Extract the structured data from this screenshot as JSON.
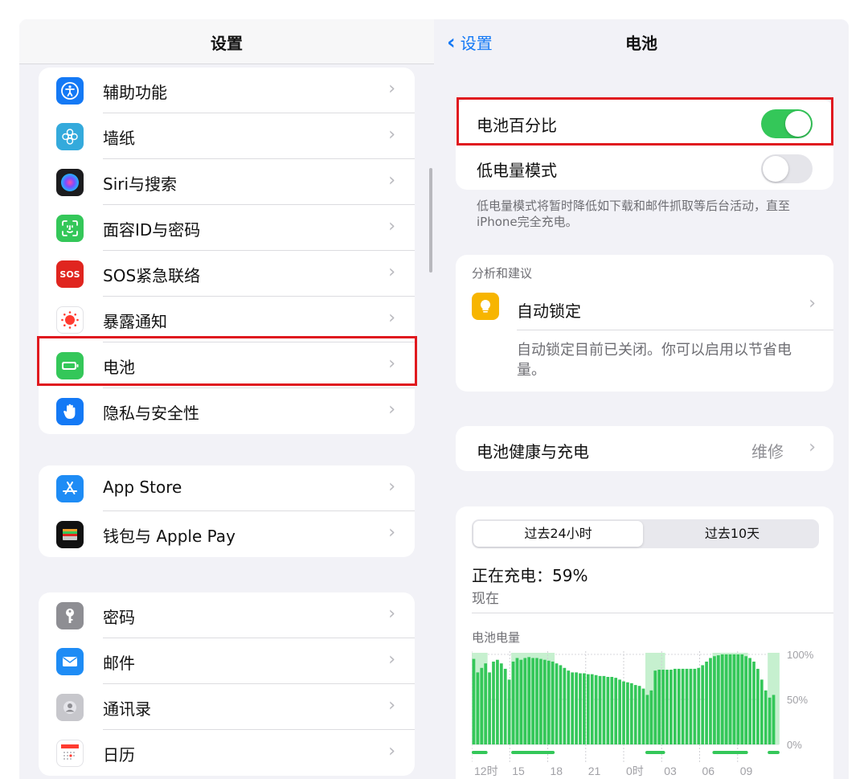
{
  "sidebar": {
    "title": "设置",
    "groups": [
      {
        "items": [
          {
            "label": "辅助功能",
            "icon": "accessibility-icon",
            "color": "#1479f5"
          },
          {
            "label": "墙纸",
            "icon": "wallpaper-flower-icon",
            "color": "#34aadc"
          },
          {
            "label": "Siri与搜索",
            "icon": "siri-icon",
            "color": "#222222"
          },
          {
            "label": "面容ID与密码",
            "icon": "face-id-icon",
            "color": "#34c759"
          },
          {
            "label": "SOS紧急联络",
            "icon": "sos-icon",
            "color": "#e0251f"
          },
          {
            "label": "暴露通知",
            "icon": "exposure-notification-icon",
            "color": "#ffffff"
          },
          {
            "label": "电池",
            "icon": "battery-icon",
            "color": "#34c759"
          },
          {
            "label": "隐私与安全性",
            "icon": "privacy-hand-icon",
            "color": "#1479f5"
          }
        ]
      },
      {
        "items": [
          {
            "label": "App Store",
            "icon": "app-store-icon",
            "color": "#1e8cf5"
          },
          {
            "label": "钱包与 Apple Pay",
            "icon": "wallet-icon",
            "color": "#111111"
          }
        ]
      },
      {
        "items": [
          {
            "label": "密码",
            "icon": "key-icon",
            "color": "#8e8e93"
          },
          {
            "label": "邮件",
            "icon": "mail-icon",
            "color": "#1e8cf5"
          },
          {
            "label": "通讯录",
            "icon": "contacts-icon",
            "color": "#c7c7cc"
          },
          {
            "label": "日历",
            "icon": "calendar-icon",
            "color": "#ffffff"
          }
        ]
      }
    ]
  },
  "detail": {
    "back_label": "设置",
    "title": "电池",
    "battery_percentage": {
      "label": "电池百分比",
      "on": true
    },
    "low_power": {
      "label": "低电量模式",
      "on": false
    },
    "low_power_note": "低电量模式将暂时降低如下载和邮件抓取等后台活动，直至iPhone完全充电。",
    "insights": {
      "section_label": "分析和建议",
      "title": "自动锁定",
      "description": "自动锁定目前已关闭。你可以启用以节省电量。"
    },
    "health": {
      "label": "电池健康与充电",
      "value": "维修"
    },
    "usage": {
      "tabs": [
        "过去24小时",
        "过去10天"
      ],
      "selected_tab": 0,
      "status": "正在充电：59%",
      "status_time": "现在",
      "chart_title": "电池电量"
    }
  },
  "chart_data": {
    "type": "bar",
    "title": "电池电量",
    "ylim": [
      0,
      100
    ],
    "y_ticks": [
      "100%",
      "50%",
      "0%"
    ],
    "x_ticks": [
      "12时",
      "15",
      "18",
      "21",
      "0时",
      "03",
      "06",
      "09"
    ],
    "bar_color": "#34c759",
    "charging_color": "#c6f0cf",
    "values": [
      95,
      80,
      85,
      90,
      80,
      92,
      94,
      90,
      84,
      72,
      92,
      96,
      94,
      96,
      97,
      96,
      96,
      95,
      94,
      93,
      92,
      90,
      88,
      85,
      82,
      80,
      80,
      79,
      79,
      78,
      78,
      77,
      76,
      76,
      75,
      75,
      74,
      72,
      70,
      69,
      68,
      66,
      65,
      62,
      55,
      60,
      82,
      83,
      83,
      83,
      83,
      84,
      84,
      84,
      84,
      84,
      84,
      85,
      88,
      92,
      96,
      98,
      99,
      100,
      100,
      100,
      100,
      100,
      100,
      98,
      96,
      92,
      84,
      72,
      60,
      52,
      55
    ],
    "charging_ranges": [
      [
        0,
        3
      ],
      [
        10,
        20
      ],
      [
        44,
        48
      ],
      [
        61,
        69
      ],
      [
        75,
        77
      ]
    ]
  }
}
